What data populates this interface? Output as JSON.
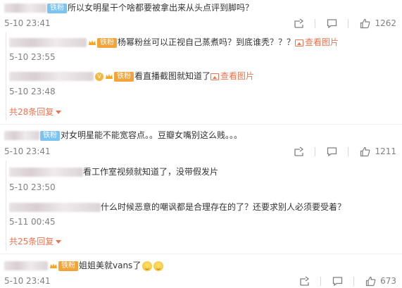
{
  "comments": [
    {
      "badge": "铁粉",
      "text": "所以女明星干个啥都要被拿出来从头点评到脚吗？",
      "time": "5-10 23:41",
      "likes": "1262",
      "replies": [
        {
          "badge": "",
          "text": "杨幂粉丝可以正视自己蒸煮吗？到底谁秃？？？",
          "link": "查看图片",
          "time": "5-10 23:55"
        },
        {
          "badge": "",
          "text": "看直播截图就知道了",
          "link": "查看图片",
          "time": "5-10 23:48"
        }
      ],
      "more": "共28条回复"
    },
    {
      "badge": "铁粉",
      "text": "对女明星能不能宽容点。。豆瓣女嘴别这么贱。。。",
      "time": "5-10 23:41",
      "likes": "1211",
      "replies": [
        {
          "text": "看工作室视频就知道了，没带假发片",
          "time": "5-10 23:50"
        },
        {
          "text": "什么时候恶意的嘲讽都是合理存在的了？还要求别人必须要受着？",
          "time": "5-11 00:45"
        }
      ],
      "more": "共25条回复"
    },
    {
      "badge": "铁粉",
      "text": "姐姐美就vans了",
      "time": "5-10 23:41",
      "likes": "673"
    }
  ],
  "icons": {
    "forward": "forward-icon",
    "comment": "comment-icon",
    "like": "like-icon",
    "picture": "picture-icon"
  },
  "colors": {
    "link": "#eb7350",
    "badge": "#7cc2f2",
    "time": "#808080"
  }
}
